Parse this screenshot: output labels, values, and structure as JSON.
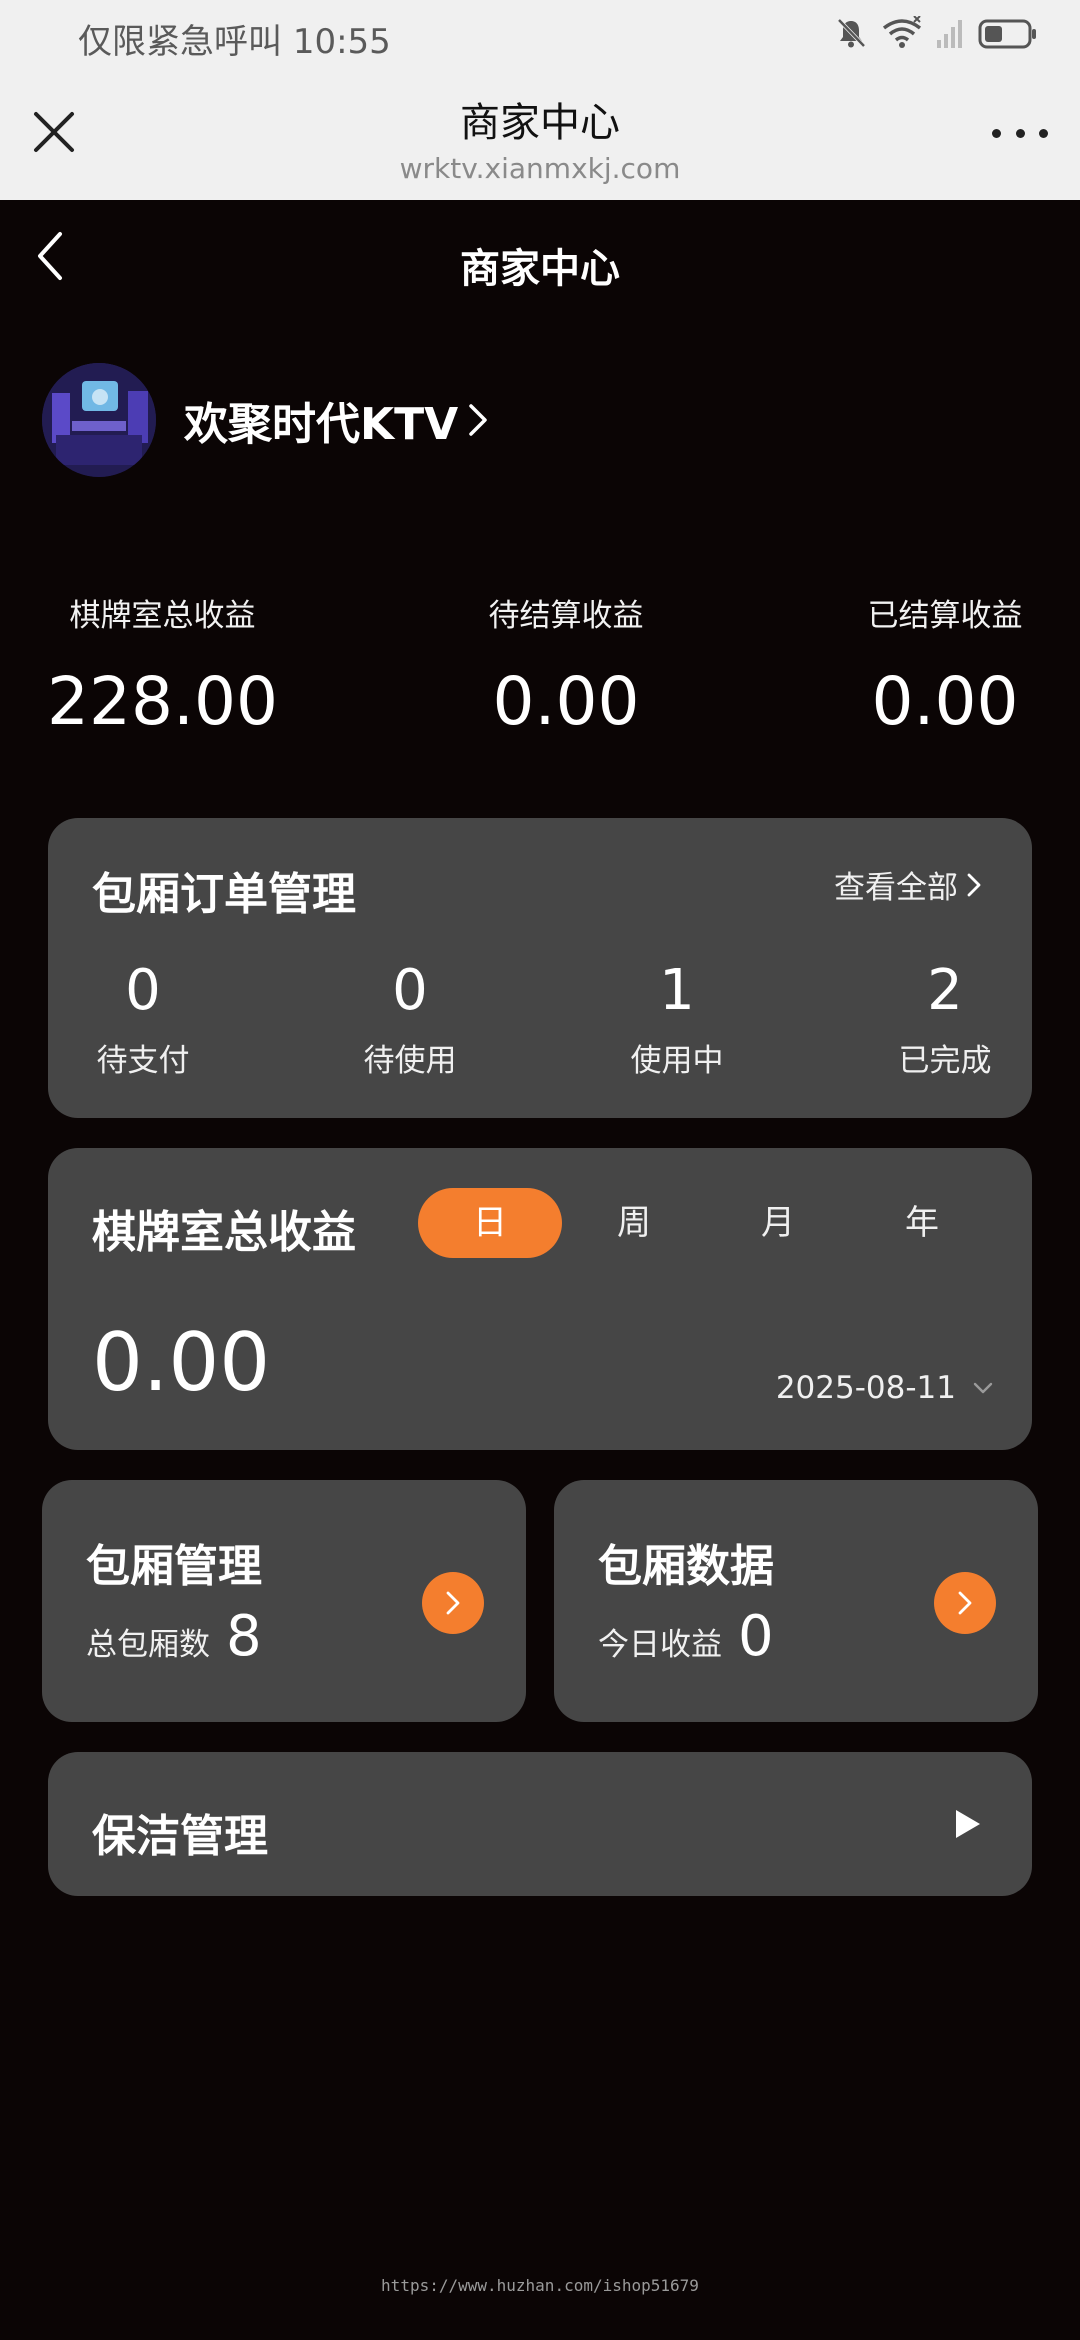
{
  "status_bar": {
    "carrier_text": "仅限紧急呼叫",
    "time": "10:55",
    "icons": [
      "bell-muted-icon",
      "wifi-icon",
      "signal-icon",
      "battery-icon"
    ]
  },
  "browser": {
    "title": "商家中心",
    "url": "wrktv.xianmxkj.com"
  },
  "header": {
    "title": "商家中心"
  },
  "store": {
    "name": "欢聚时代KTV"
  },
  "stats": [
    {
      "label": "棋牌室总收益",
      "value": "228.00"
    },
    {
      "label": "待结算收益",
      "value": "0.00"
    },
    {
      "label": "已结算收益",
      "value": "0.00"
    }
  ],
  "orders": {
    "title": "包厢订单管理",
    "view_all": "查看全部",
    "items": [
      {
        "count": "0",
        "label": "待支付"
      },
      {
        "count": "0",
        "label": "待使用"
      },
      {
        "count": "1",
        "label": "使用中"
      },
      {
        "count": "2",
        "label": "已完成"
      }
    ]
  },
  "revenue": {
    "title": "棋牌室总收益",
    "tabs": [
      "日",
      "周",
      "月",
      "年"
    ],
    "active_tab": "日",
    "amount": "0.00",
    "date": "2025-08-11"
  },
  "room_management": {
    "title": "包厢管理",
    "sub_label": "总包厢数",
    "sub_value": "8"
  },
  "room_data": {
    "title": "包厢数据",
    "sub_label": "今日收益",
    "sub_value": "0"
  },
  "cleaning": {
    "title": "保洁管理"
  },
  "watermark": "https://www.huzhan.com/ishop51679",
  "colors": {
    "accent": "#f47e2e",
    "card_bg": "#464646",
    "page_bg": "#0b0505"
  }
}
